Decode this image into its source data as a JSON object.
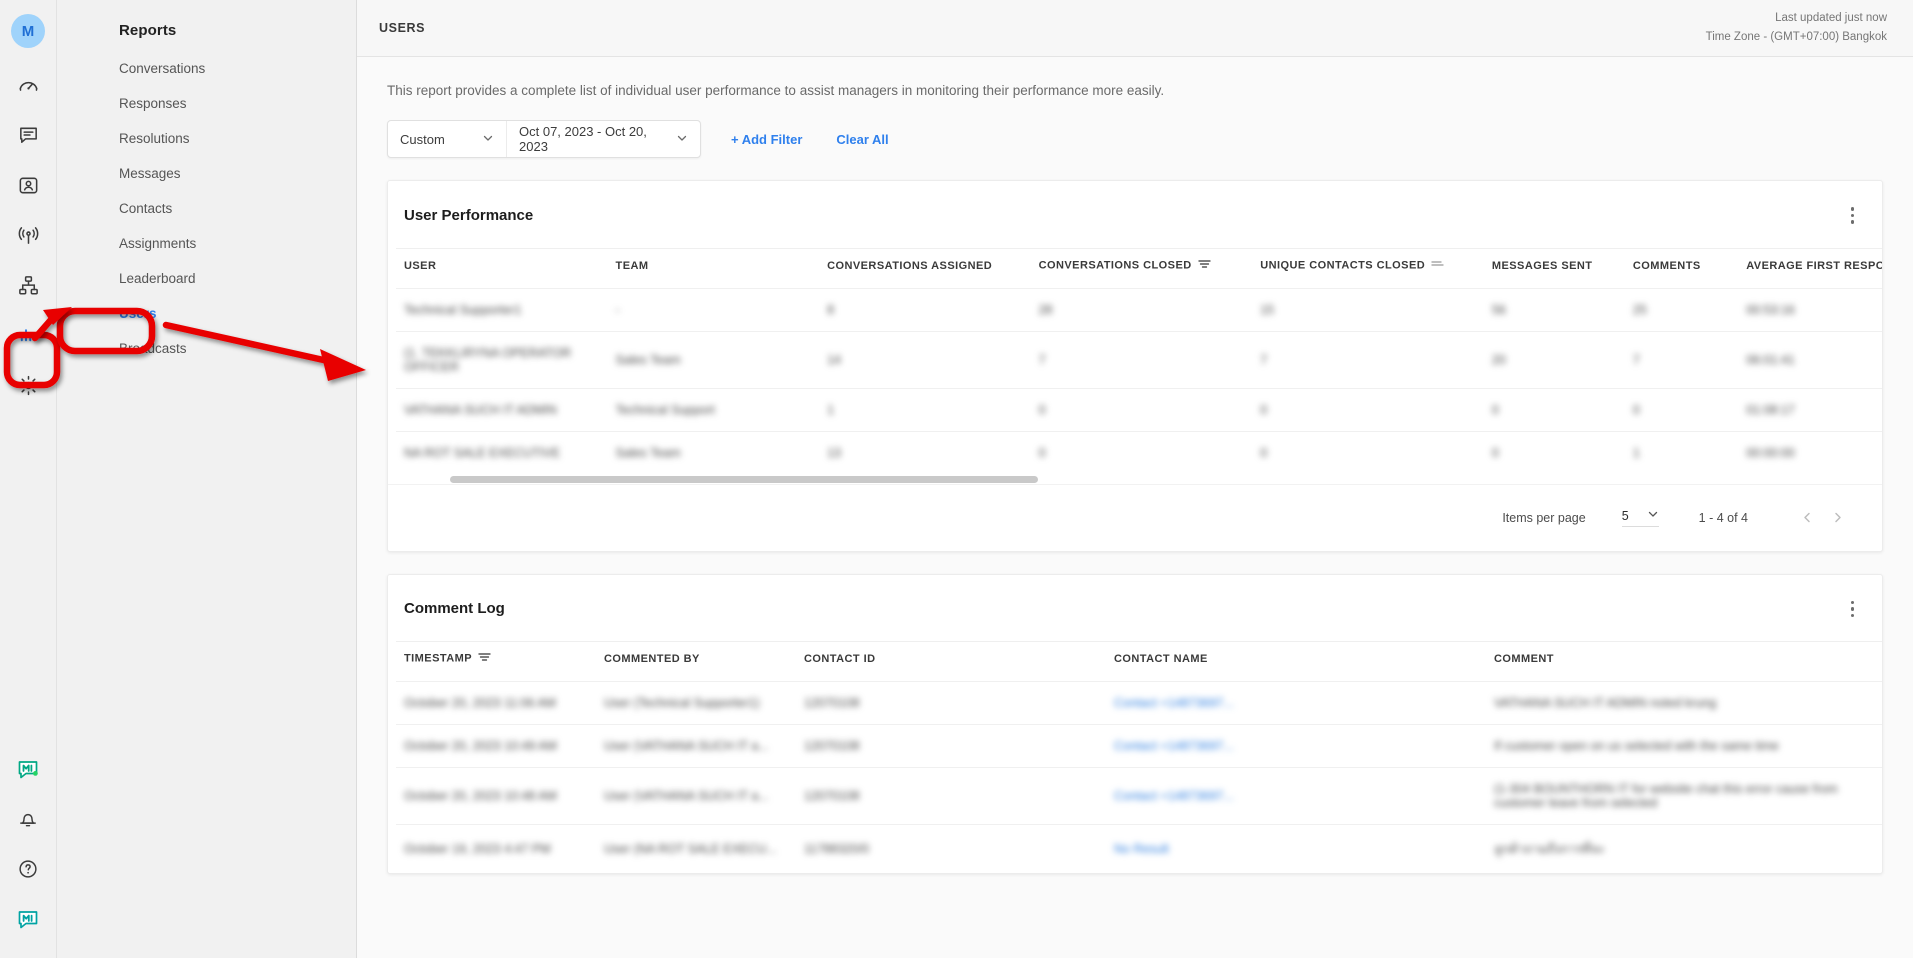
{
  "rail": {
    "avatar_initial": "M",
    "icons": [
      {
        "name": "speedometer-icon",
        "label": "Dashboard"
      },
      {
        "name": "chat-bubble-icon",
        "label": "Inbox"
      },
      {
        "name": "contact-card-icon",
        "label": "Contacts"
      },
      {
        "name": "broadcast-icon",
        "label": "Broadcasts"
      },
      {
        "name": "workflow-icon",
        "label": "Workflows"
      },
      {
        "name": "bar-chart-icon",
        "label": "Reports"
      },
      {
        "name": "gear-icon",
        "label": "Settings"
      }
    ],
    "bottom_icons": [
      {
        "name": "app-logo-icon",
        "label": "App"
      },
      {
        "name": "bell-icon",
        "label": "Notifications"
      },
      {
        "name": "question-mark-icon",
        "label": "Help"
      },
      {
        "name": "messenger-logo-icon",
        "label": "Messenger"
      }
    ]
  },
  "sidebar": {
    "title": "Reports",
    "items": [
      {
        "label": "Conversations",
        "selected": false
      },
      {
        "label": "Responses",
        "selected": false
      },
      {
        "label": "Resolutions",
        "selected": false
      },
      {
        "label": "Messages",
        "selected": false
      },
      {
        "label": "Contacts",
        "selected": false
      },
      {
        "label": "Assignments",
        "selected": false
      },
      {
        "label": "Leaderboard",
        "selected": false
      },
      {
        "label": "Users",
        "selected": true
      },
      {
        "label": "Broadcasts",
        "selected": false
      }
    ]
  },
  "topbar": {
    "title": "USERS",
    "last_updated": "Last updated just now",
    "timezone": "Time Zone - (GMT+07:00) Bangkok"
  },
  "report": {
    "description": "This report provides a complete list of individual user performance to assist managers in monitoring their performance more easily."
  },
  "filters": {
    "period_value": "Custom",
    "date_range_value": "Oct 07, 2023 - Oct 20, 2023",
    "add_filter_label": "+ Add Filter",
    "clear_all_label": "Clear All"
  },
  "user_performance": {
    "title": "User Performance",
    "columns": [
      {
        "label": "USER",
        "sort": false
      },
      {
        "label": "TEAM",
        "sort": false
      },
      {
        "label": "CONVERSATIONS ASSIGNED",
        "sort": false
      },
      {
        "label": "CONVERSATIONS CLOSED",
        "sort": true
      },
      {
        "label": "UNIQUE CONTACTS CLOSED",
        "sort": true
      },
      {
        "label": "MESSAGES SENT",
        "sort": false
      },
      {
        "label": "COMMENTS",
        "sort": false
      },
      {
        "label": "AVERAGE FIRST RESPONSE TIM",
        "sort": false
      }
    ],
    "rows": [
      {
        "user": "Technical Supporter1",
        "team": "-",
        "conversations_assigned": "8",
        "conversations_closed": "28",
        "unique_contacts_closed": "15",
        "messages_sent": "56",
        "comments": "25",
        "avg_first_response_time": "00:53:16"
      },
      {
        "user": "(1. TEKKLIRYNA OPERATOR OFFICER",
        "team": "Sales Team",
        "conversations_assigned": "14",
        "conversations_closed": "7",
        "unique_contacts_closed": "7",
        "messages_sent": "20",
        "comments": "7",
        "avg_first_response_time": "06:01:41"
      },
      {
        "user": "VATHANA SUCH IT ADMIN",
        "team": "Technical Support",
        "conversations_assigned": "1",
        "conversations_closed": "0",
        "unique_contacts_closed": "0",
        "messages_sent": "0",
        "comments": "0",
        "avg_first_response_time": "01:08:17"
      },
      {
        "user": "NA ROT SALE EXECUTIVE",
        "team": "Sales Team",
        "conversations_assigned": "13",
        "conversations_closed": "0",
        "unique_contacts_closed": "0",
        "messages_sent": "0",
        "comments": "1",
        "avg_first_response_time": "00:00:00"
      }
    ],
    "pager": {
      "items_per_page_label": "Items per page",
      "items_per_page_value": "5",
      "range_label": "1 - 4 of 4"
    }
  },
  "comment_log": {
    "title": "Comment Log",
    "columns": [
      {
        "label": "TIMESTAMP",
        "sort": true
      },
      {
        "label": "COMMENTED BY",
        "sort": false
      },
      {
        "label": "CONTACT ID",
        "sort": false
      },
      {
        "label": "CONTACT NAME",
        "sort": false
      },
      {
        "label": "COMMENT",
        "sort": false
      }
    ],
    "rows": [
      {
        "timestamp": "October 20, 2023 11:06 AM",
        "commented_by": "User (Technical Supporter1)",
        "contact_id": "12070108",
        "contact_name": "Contact +14873697...",
        "comment": "VATHANA SUCH IT ADMIN noted krung"
      },
      {
        "timestamp": "October 20, 2023 10:49 AM",
        "commented_by": "User (VATHANA SUCH IT a...",
        "contact_id": "12070108",
        "contact_name": "Contact +14873697...",
        "comment": "If customer open on us selected with the same time"
      },
      {
        "timestamp": "October 20, 2023 10:48 AM",
        "commented_by": "User (VATHANA SUCH IT a...",
        "contact_id": "12070108",
        "contact_name": "Contact +14873697...",
        "comment": "(1-304 BOUNTHORN IT for website chat this error cause from customer leave from selected"
      },
      {
        "timestamp": "October 19, 2023 4:47 PM",
        "commented_by": "User (NA ROT SALE EXECU...",
        "contact_id": "11788320/0",
        "contact_name": "No Result",
        "comment": "ลูกค้าถามถึงการที่จะ"
      }
    ]
  },
  "annotations": {
    "color": "#e80000",
    "highlight_rail_icon": "bar-chart-icon",
    "highlight_nav_item": "Users"
  },
  "colors": {
    "accent": "#2f80ed",
    "annotation": "#e80000",
    "rail_bg": "#f1f1f1",
    "nav_bg": "#f1f1f1",
    "content_bg": "#fafafa",
    "card_bg": "#ffffff"
  }
}
